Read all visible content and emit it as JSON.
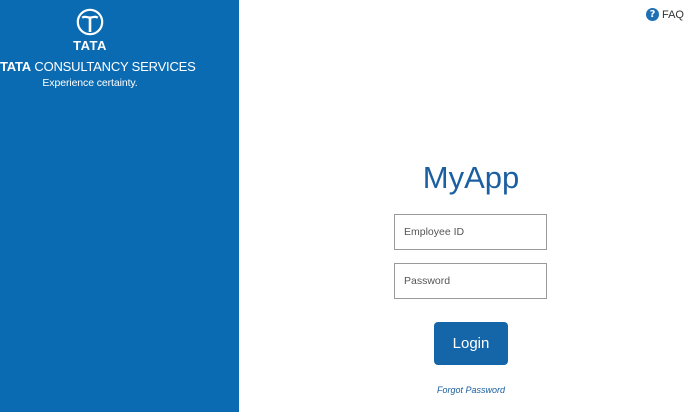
{
  "brand": {
    "wordmark": "TATA",
    "company_bold": "TATA",
    "company_rest": "CONSULTANCY SERVICES",
    "tagline": "Experience certainty.",
    "panel_color": "#0b6bb2",
    "logo_icon": "tata-logo-icon"
  },
  "header": {
    "faq_icon": "question-circle-icon",
    "faq_label": "FAQ"
  },
  "login": {
    "app_title": "MyApp",
    "employee_id": {
      "placeholder": "Employee ID",
      "value": ""
    },
    "password": {
      "placeholder": "Password",
      "value": ""
    },
    "login_label": "Login",
    "forgot_label": "Forgot Password",
    "accent_color": "#1565a9"
  }
}
